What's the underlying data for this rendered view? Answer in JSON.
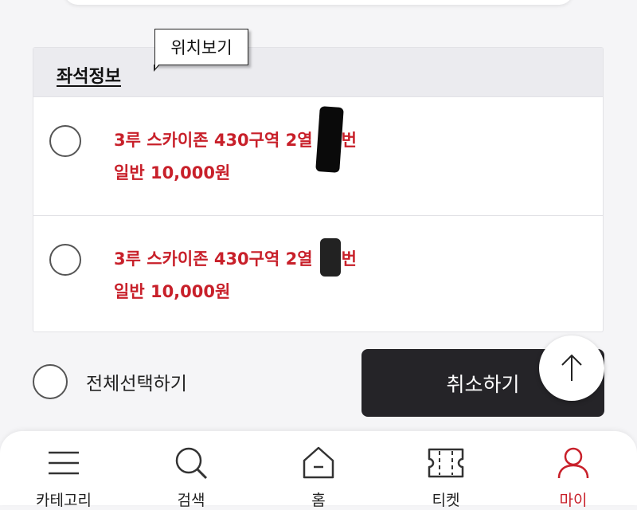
{
  "seat_info": {
    "title": "좌석정보",
    "tooltip": "위치보기",
    "rows": [
      {
        "seat": "3루 스카이존 430구역 2열",
        "suffix": "번",
        "price": "일반 10,000원"
      },
      {
        "seat": "3루 스카이존 430구역 2열",
        "suffix": "번",
        "price": "일반 10,000원"
      }
    ]
  },
  "actions": {
    "select_all": "전체선택하기",
    "cancel": "취소하기"
  },
  "nav": {
    "items": [
      {
        "label": "카테고리",
        "icon": "menu-icon"
      },
      {
        "label": "검색",
        "icon": "search-icon"
      },
      {
        "label": "홈",
        "icon": "home-icon"
      },
      {
        "label": "티켓",
        "icon": "ticket-icon"
      },
      {
        "label": "마이",
        "icon": "user-icon"
      }
    ],
    "active": "마이"
  },
  "colors": {
    "accent": "#c8202a",
    "button_dark": "#252428",
    "background": "#f5f5f7"
  }
}
